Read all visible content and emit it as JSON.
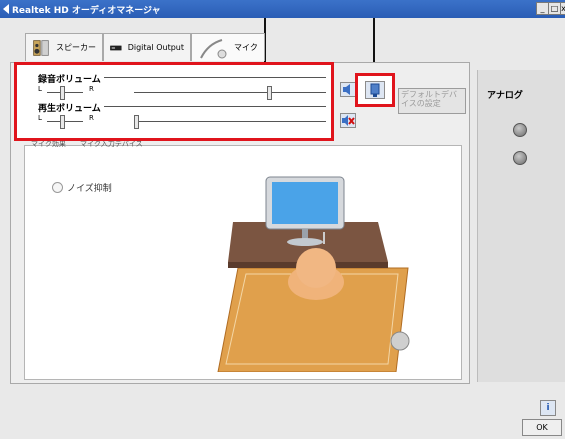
{
  "window": {
    "title": "Realtek HD オーディオマネージャ",
    "minimize": "_",
    "maximize": "□",
    "close": "x"
  },
  "tabs": [
    {
      "label": "スピーカー",
      "icon": "speaker-icon"
    },
    {
      "label": "Digital Output",
      "icon": "digital-output-icon"
    },
    {
      "label": "マイク",
      "icon": "microphone-icon"
    }
  ],
  "recording_volume": {
    "label": "録音ボリューム",
    "left": "L",
    "right": "R",
    "balance": 0.28,
    "level": 0.75
  },
  "playback_volume": {
    "label": "再生ボリューム",
    "left": "L",
    "right": "R",
    "balance": 0.28,
    "level": 0.0
  },
  "default_device_button": "デフォルトデバイスの設定",
  "analog": {
    "label": "アナログ"
  },
  "subtabs": [
    "マイク効果",
    "マイク入力デバイス"
  ],
  "noise_suppression": {
    "label": "ノイズ抑制"
  },
  "ok_button": "OK",
  "info_icon": "info-icon",
  "colors": {
    "highlight": "#e0141c",
    "titlebar": "#2a5db5"
  }
}
